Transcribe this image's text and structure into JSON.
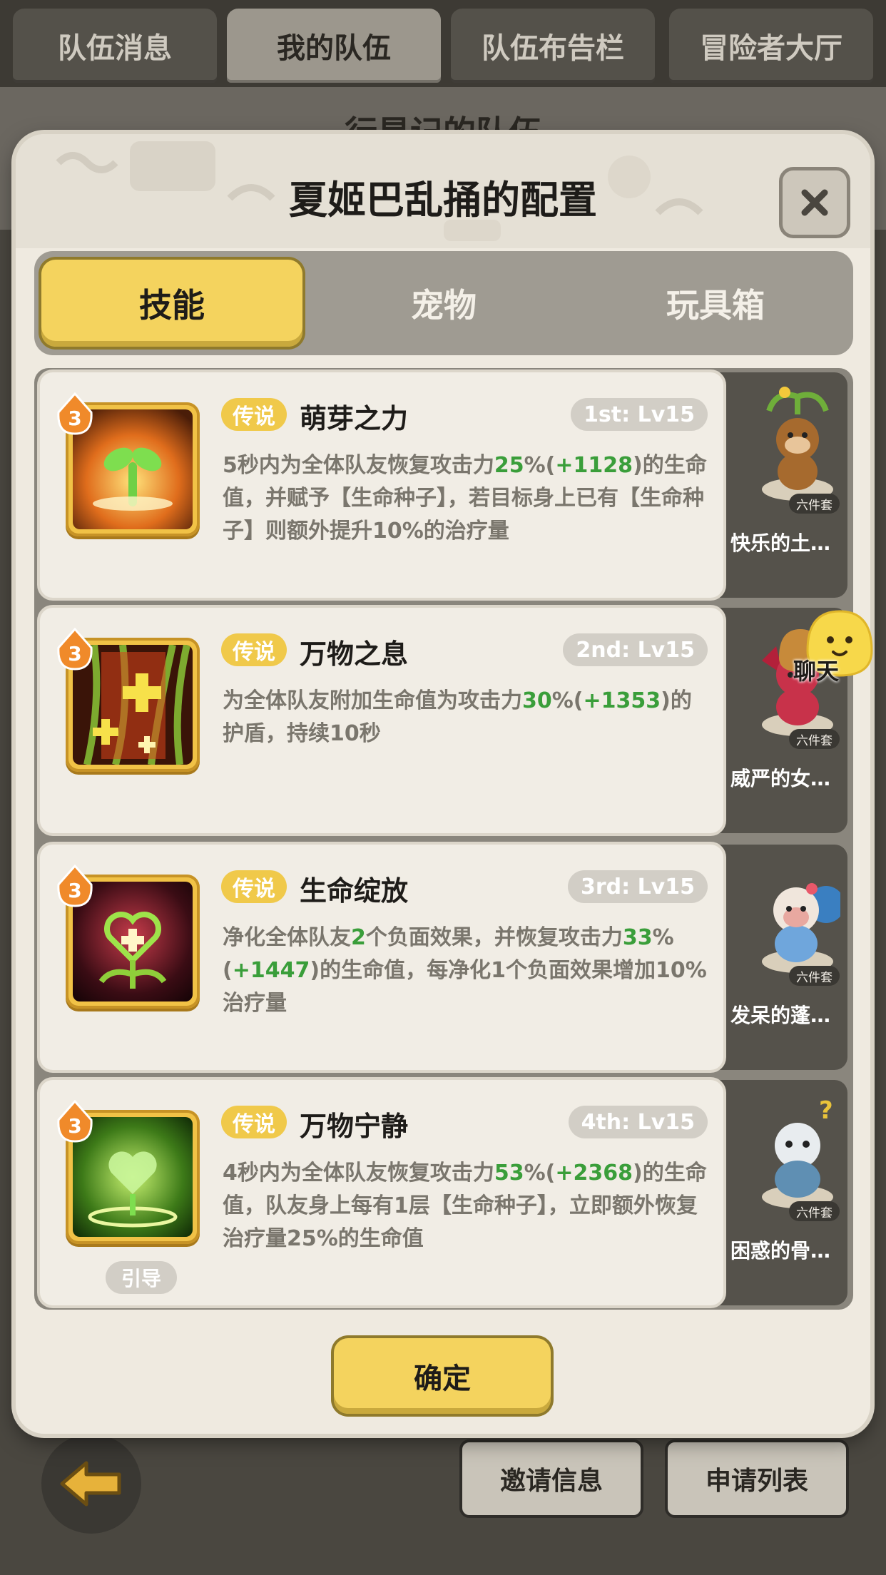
{
  "top_tabs": [
    {
      "label": "队伍消息",
      "active": false
    },
    {
      "label": "我的队伍",
      "active": true
    },
    {
      "label": "队伍布告栏",
      "active": false
    },
    {
      "label": "冒险者大厅",
      "active": false
    }
  ],
  "background": {
    "team_title": "行星记的队伍"
  },
  "modal": {
    "title": "夏姬巴乱捅的配置",
    "close_icon": "close-x-icon",
    "tabs": [
      "技能",
      "宠物",
      "玩具箱"
    ],
    "active_tab": "技能",
    "confirm_label": "确定"
  },
  "skills": [
    {
      "level": "3",
      "rarity": "传说",
      "name": "萌芽之力",
      "slot": "1st: Lv15",
      "desc": [
        {
          "t": "5秒内为全体队友恢复攻击力"
        },
        {
          "t": "25",
          "g": true
        },
        {
          "t": "%("
        },
        {
          "t": "+1128",
          "g": true
        },
        {
          "t": ")的生命值，并赋予【生命种子】，若目标身上已有【生命种子】则额外提升10%的治疗量"
        }
      ],
      "icon": "sprout-icon",
      "guide": "",
      "pet": {
        "name": "快乐的土…",
        "tag": "六件套",
        "icon": "monkey-pet-icon"
      }
    },
    {
      "level": "3",
      "rarity": "传说",
      "name": "万物之息",
      "slot": "2nd: Lv15",
      "desc": [
        {
          "t": "为全体队友附加生命值为攻击力"
        },
        {
          "t": "30",
          "g": true
        },
        {
          "t": "%("
        },
        {
          "t": "+1353",
          "g": true
        },
        {
          "t": ")的护盾，持续10秒"
        }
      ],
      "icon": "healing-cross-icon",
      "guide": "",
      "pet": {
        "name": "威严的女…",
        "tag": "六件套",
        "icon": "dragon-pet-icon"
      }
    },
    {
      "level": "3",
      "rarity": "传说",
      "name": "生命绽放",
      "slot": "3rd: Lv15",
      "desc": [
        {
          "t": "净化全体队友"
        },
        {
          "t": "2",
          "g": true
        },
        {
          "t": "个负面效果，并恢复攻击力"
        },
        {
          "t": "33",
          "g": true
        },
        {
          "t": "%("
        },
        {
          "t": "+1447",
          "g": true
        },
        {
          "t": ")的生命值，每净化1个负面效果增加10%治疗量"
        }
      ],
      "icon": "heart-flower-icon",
      "guide": "",
      "pet": {
        "name": "发呆的蓬…",
        "tag": "六件套",
        "icon": "sheep-pet-icon"
      }
    },
    {
      "level": "3",
      "rarity": "传说",
      "name": "万物宁静",
      "slot": "4th: Lv15",
      "desc": [
        {
          "t": "4秒内为全体队友恢复攻击力"
        },
        {
          "t": "53",
          "g": true
        },
        {
          "t": "%("
        },
        {
          "t": "+2368",
          "g": true
        },
        {
          "t": ")的生命值，队友身上每有1层【生命种子】，立即额外恢复治疗量25%的生命值"
        }
      ],
      "icon": "heart-leaves-icon",
      "guide": "引导",
      "pet": {
        "name": "困惑的骨…",
        "tag": "六件套",
        "icon": "bone-dragon-pet-icon"
      }
    }
  ],
  "bottom": {
    "back_icon": "back-arrow-icon",
    "invite_label": "邀请信息",
    "apply_label": "申请列表"
  },
  "chat": {
    "label": "聊天"
  }
}
